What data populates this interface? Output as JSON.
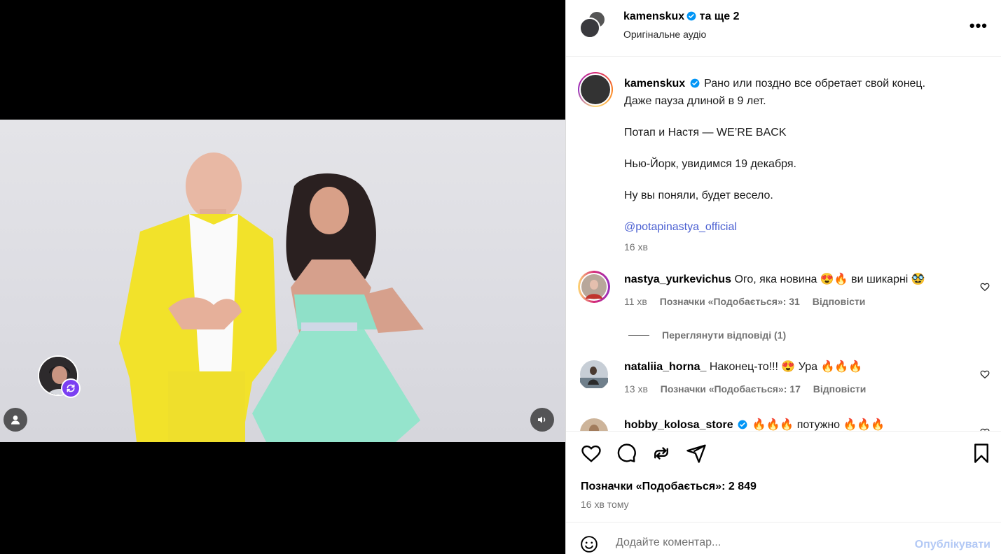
{
  "header": {
    "username": "kamenskux",
    "coauthors": "та ще 2",
    "audio": "Оригінальне аудіо",
    "more_label": "•••"
  },
  "caption": {
    "username": "kamenskux",
    "text_line1": "Рано или поздно все обретает свой конец.",
    "text_line2": "Даже пауза длиной в 9 лет.",
    "text_line3": "Потап и Настя — WE’RE BACK",
    "text_line4": "Нью-Йорк, увидимся 19 декабря.",
    "text_line5": "Ну вы поняли, будет весело.",
    "mention": "@potapinastya_official",
    "time": "16 хв"
  },
  "comments": [
    {
      "username": "nastya_yurkevichus",
      "text": "Ого, яка новина 😍🔥 ви шикарні 🥸",
      "time": "11 хв",
      "likes": "Позначки «Подобається»: 31",
      "reply": "Відповісти"
    },
    {
      "username": "nataliia_horna_",
      "text": "Наконец-то!!! 😍 Ура 🔥🔥🔥",
      "time": "13 хв",
      "likes": "Позначки «Подобається»: 17",
      "reply": "Відповісти"
    },
    {
      "username": "hobby_kolosa_store",
      "text": "🔥🔥🔥 потужно 🔥🔥🔥"
    }
  ],
  "view_replies": "Переглянути відповіді (1)",
  "post": {
    "likes": "Позначки «Подобається»: 2 849",
    "time_ago": "16 хв тому"
  },
  "composer": {
    "placeholder": "Додайте коментар...",
    "publish": "Опублікувати"
  },
  "colors": {
    "link": "#4a5fd1",
    "verified": "#0095f6",
    "muted": "#737373",
    "publish_disabled": "#b3c9f5",
    "remix": "#7b3ff2"
  }
}
